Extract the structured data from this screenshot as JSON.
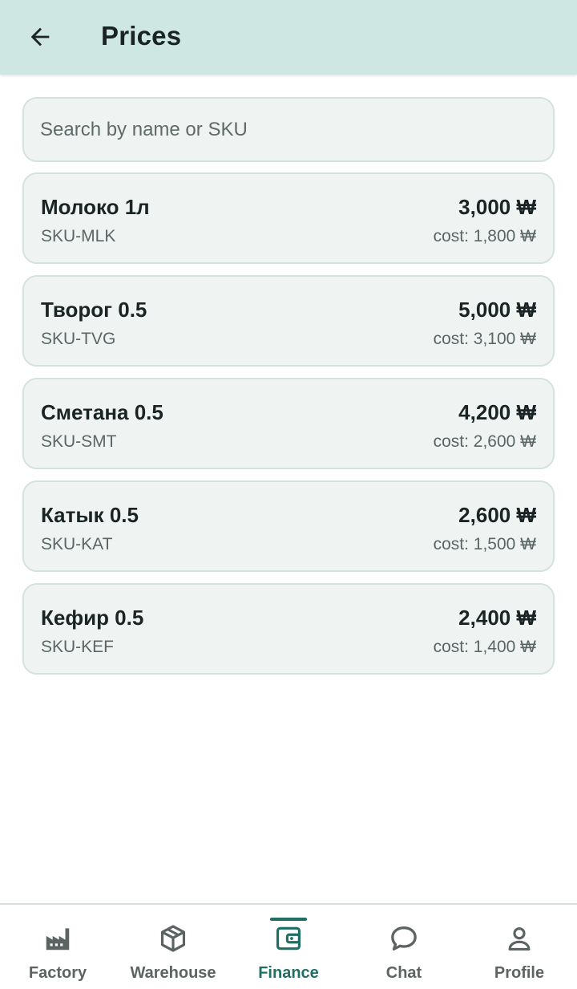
{
  "header": {
    "title": "Prices",
    "back_icon": "arrow-left-icon"
  },
  "search": {
    "placeholder": "Search by name or SKU",
    "value": ""
  },
  "products": [
    {
      "name": "Молоко 1л",
      "sku": "SKU-MLK",
      "price": "3,000 ₩",
      "cost": "cost: 1,800 ₩"
    },
    {
      "name": "Творог 0.5",
      "sku": "SKU-TVG",
      "price": "5,000 ₩",
      "cost": "cost: 3,100 ₩"
    },
    {
      "name": "Сметана 0.5",
      "sku": "SKU-SMT",
      "price": "4,200 ₩",
      "cost": "cost: 2,600 ₩"
    },
    {
      "name": "Катык 0.5",
      "sku": "SKU-KAT",
      "price": "2,600 ₩",
      "cost": "cost: 1,500 ₩"
    },
    {
      "name": "Кефир 0.5",
      "sku": "SKU-KEF",
      "price": "2,400 ₩",
      "cost": "cost: 1,400 ₩"
    }
  ],
  "nav": {
    "items": [
      {
        "label": "Factory",
        "icon": "factory-icon",
        "active": false
      },
      {
        "label": "Warehouse",
        "icon": "box-icon",
        "active": false
      },
      {
        "label": "Finance",
        "icon": "wallet-icon",
        "active": true
      },
      {
        "label": "Chat",
        "icon": "chat-bubble-icon",
        "active": false
      },
      {
        "label": "Profile",
        "icon": "person-icon",
        "active": false
      }
    ]
  },
  "colors": {
    "header_bg": "#cfe7e3",
    "card_bg": "#eff4f3",
    "card_border": "#d3e2df",
    "accent": "#1f6f64",
    "text_primary": "#1b2424",
    "text_secondary": "#5a6564"
  }
}
